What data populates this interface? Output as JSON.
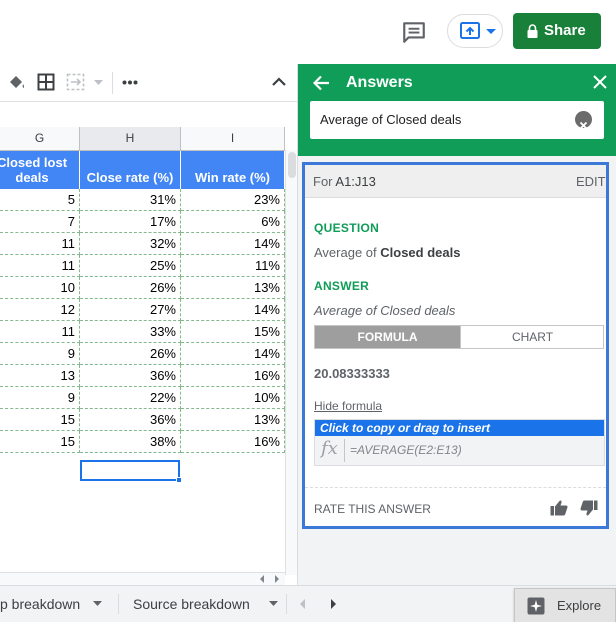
{
  "topbar": {
    "share_label": "Share"
  },
  "grid": {
    "columns": [
      "G",
      "H",
      "I"
    ],
    "headers": [
      "Closed lost deals",
      "Close rate (%)",
      "Win rate (%)"
    ],
    "rows": [
      [
        "5",
        "31%",
        "23%"
      ],
      [
        "7",
        "17%",
        "6%"
      ],
      [
        "11",
        "32%",
        "14%"
      ],
      [
        "11",
        "25%",
        "11%"
      ],
      [
        "10",
        "26%",
        "13%"
      ],
      [
        "12",
        "27%",
        "14%"
      ],
      [
        "11",
        "33%",
        "15%"
      ],
      [
        "9",
        "26%",
        "14%"
      ],
      [
        "13",
        "36%",
        "16%"
      ],
      [
        "9",
        "22%",
        "10%"
      ],
      [
        "15",
        "36%",
        "13%"
      ],
      [
        "15",
        "38%",
        "16%"
      ]
    ]
  },
  "tabs": {
    "tab1": "p breakdown",
    "tab2": "Source breakdown",
    "explore": "Explore"
  },
  "answers": {
    "title": "Answers",
    "query": "Average of Closed deals",
    "range_prefix": "For ",
    "range": "A1:J13",
    "edit": "EDIT",
    "question_label": "QUESTION",
    "question_prefix": "Average of ",
    "question_bold": "Closed deals",
    "answer_label": "ANSWER",
    "answer_sub": "Average of Closed deals",
    "formula_tab": "FORMULA",
    "chart_tab": "CHART",
    "result": "20.08333333",
    "hide_formula": "Hide formula",
    "insert_hint": "Click to copy or drag to insert",
    "fx": "fx",
    "formula": "=AVERAGE(E2:E13)",
    "rate": "RATE THIS ANSWER"
  },
  "colors": {
    "green": "#0f9d58",
    "share_green": "#188038",
    "header_blue": "#4285f4",
    "select_blue": "#1a73e8"
  }
}
